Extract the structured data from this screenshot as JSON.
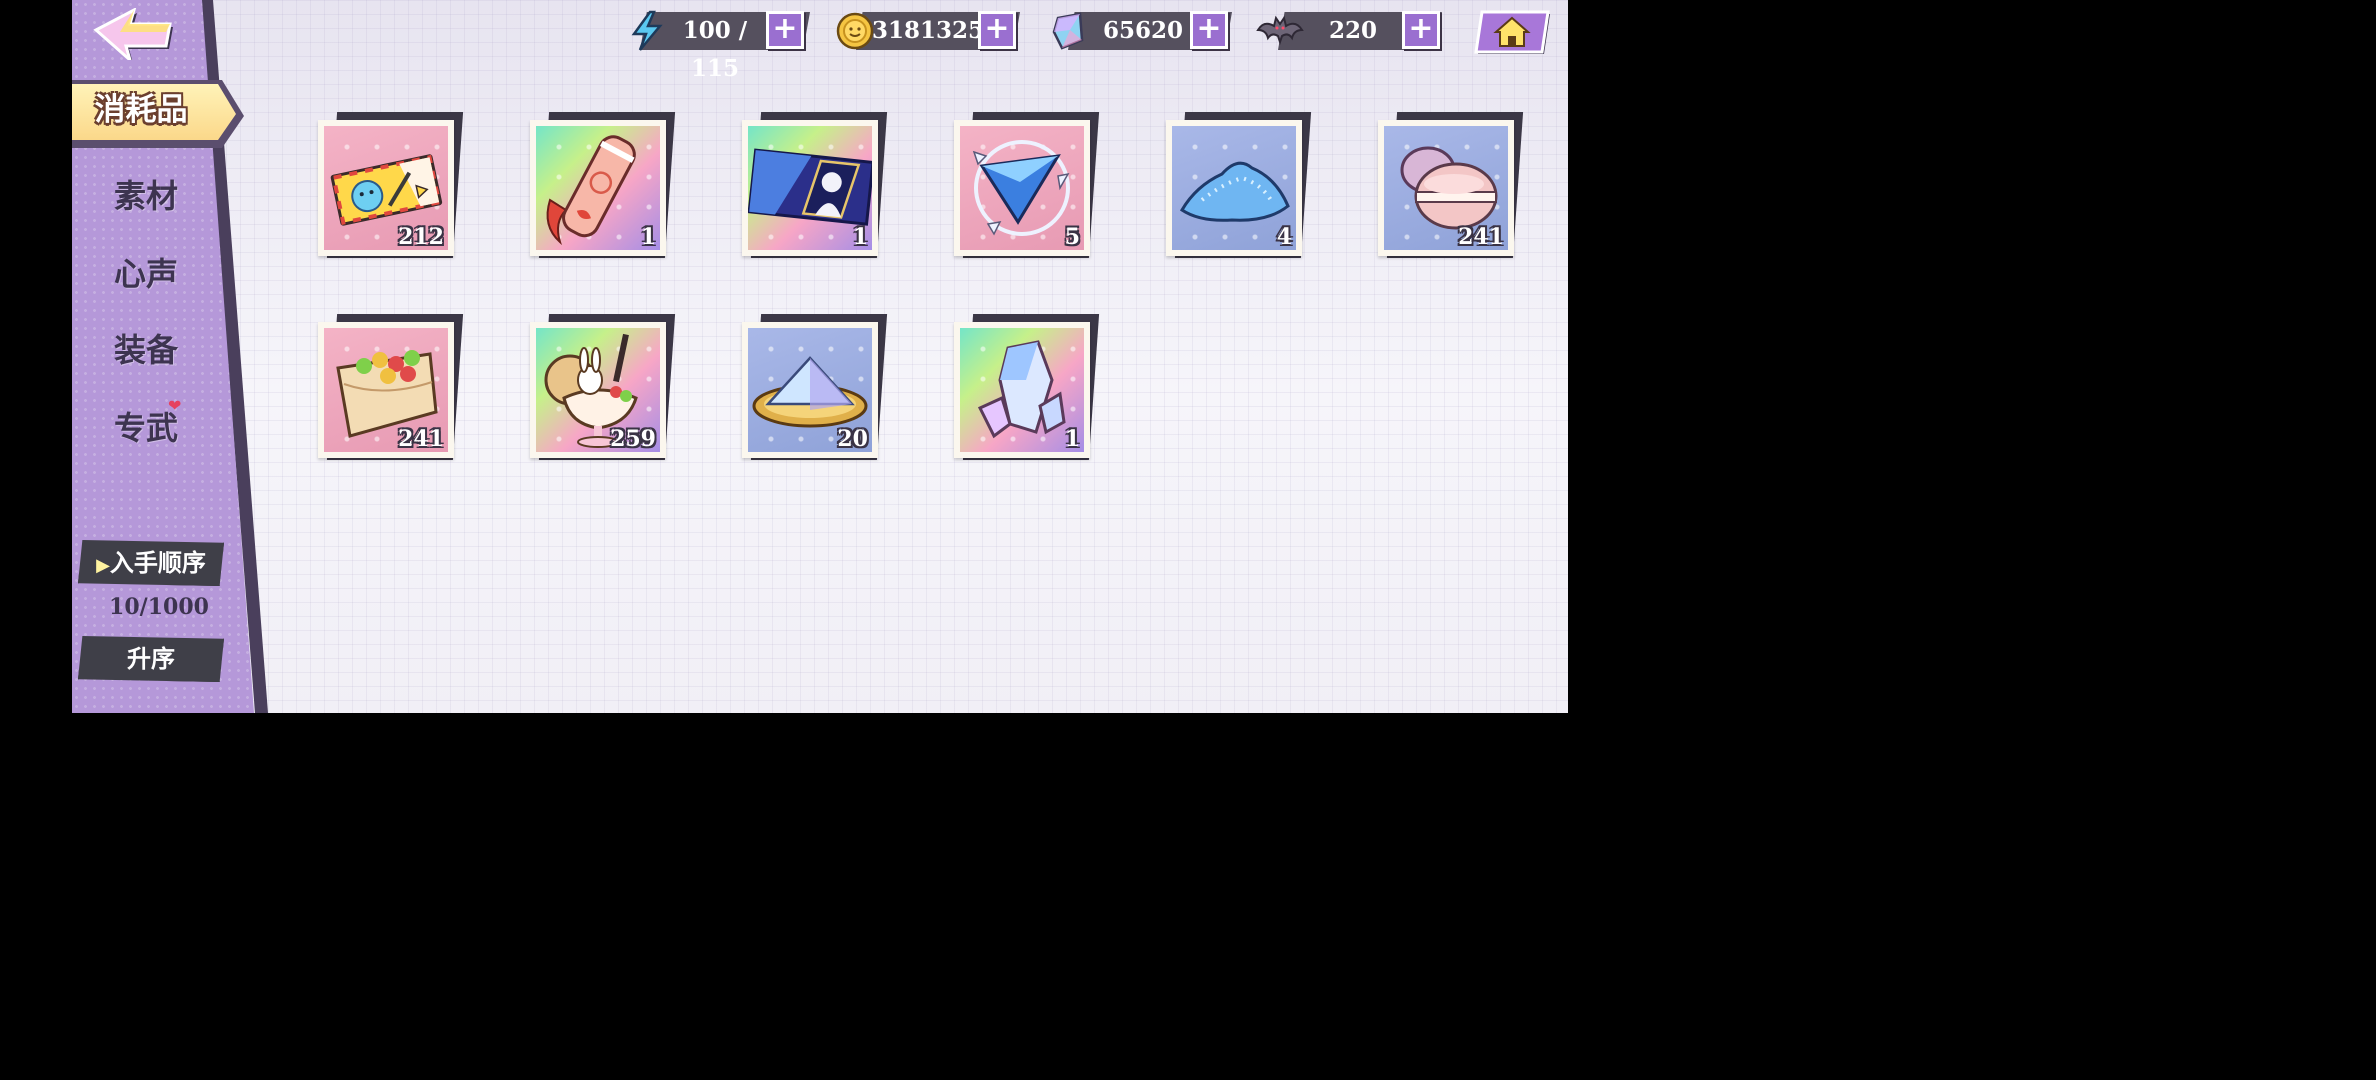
{
  "sidebar": {
    "active_tab": "消耗品",
    "items": [
      {
        "label": "素材"
      },
      {
        "label": "心声"
      },
      {
        "label": "装备"
      },
      {
        "label": "专武"
      }
    ],
    "sort": {
      "order_label": "入手顺序",
      "count": "10/1000",
      "direction_label": "升序"
    }
  },
  "resources": {
    "stamina": {
      "value": "100 / 115",
      "icon": "lightning-icon"
    },
    "coins": {
      "value": "3181325",
      "icon": "coin-icon"
    },
    "gems": {
      "value": "65620",
      "icon": "crystal-icon"
    },
    "bat_tokens": {
      "value": "220",
      "icon": "bat-icon"
    }
  },
  "items": [
    {
      "name": "ticket",
      "count": "212",
      "background": "pink"
    },
    {
      "name": "candle-scroll",
      "count": "1",
      "background": "rainbow"
    },
    {
      "name": "character-ticket",
      "count": "1",
      "background": "rainbow"
    },
    {
      "name": "triangle-gem",
      "count": "5",
      "background": "pink"
    },
    {
      "name": "blue-powder",
      "count": "4",
      "background": "blue"
    },
    {
      "name": "macaron",
      "count": "241",
      "background": "blue"
    },
    {
      "name": "crepe",
      "count": "241",
      "background": "pink"
    },
    {
      "name": "parfait",
      "count": "259",
      "background": "rainbow"
    },
    {
      "name": "crystal-sand-plate",
      "count": "20",
      "background": "blue"
    },
    {
      "name": "crystal-cluster",
      "count": "1",
      "background": "rainbow"
    }
  ],
  "colors": {
    "sidebar": "#b598d9",
    "accent_purple": "#9a6fd0",
    "plate_dark": "#3f3f48",
    "active_tab": "#fbd88a"
  }
}
